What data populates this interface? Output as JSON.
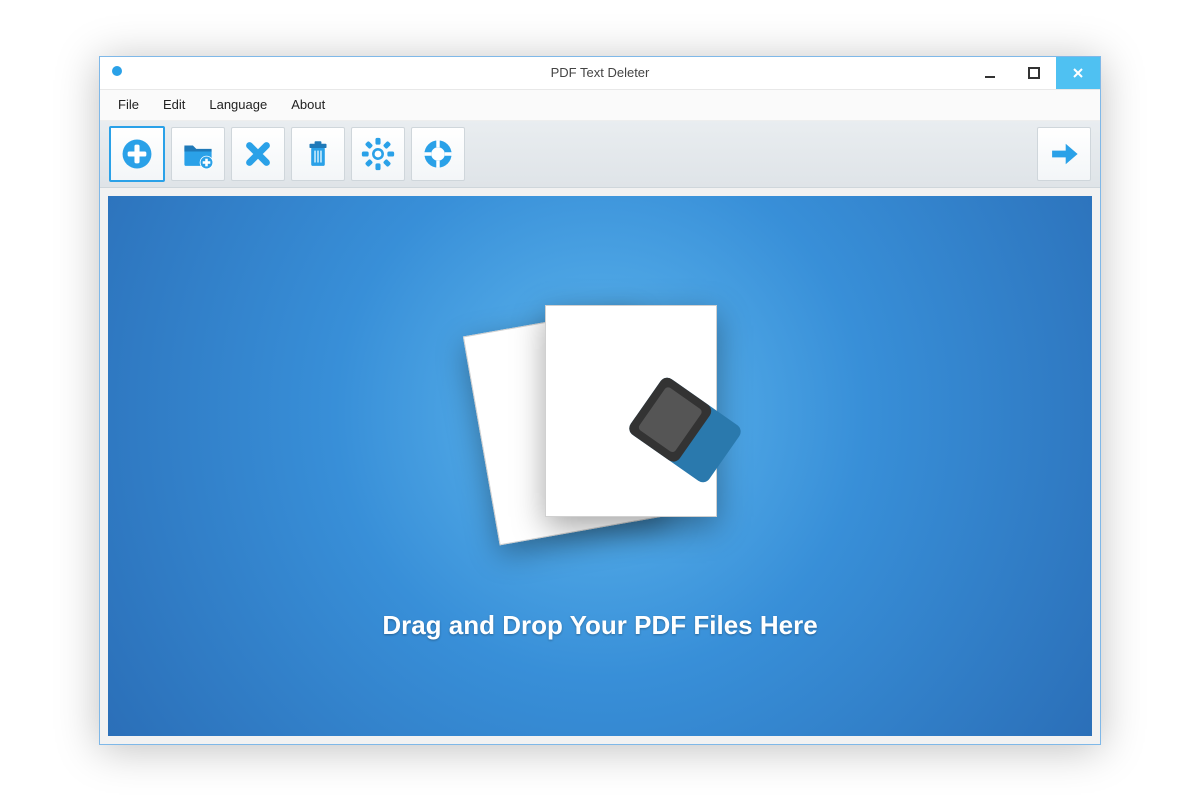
{
  "window": {
    "title": "PDF Text Deleter"
  },
  "menu": {
    "items": [
      "File",
      "Edit",
      "Language",
      "About"
    ]
  },
  "toolbar": {
    "add": {
      "name": "add-file",
      "icon": "plus-icon"
    },
    "add_folder": {
      "name": "add-folder",
      "icon": "folder-plus-icon"
    },
    "remove": {
      "name": "remove",
      "icon": "x-icon"
    },
    "clear": {
      "name": "clear-all",
      "icon": "trash-icon"
    },
    "settings": {
      "name": "settings",
      "icon": "gear-icon"
    },
    "help": {
      "name": "help",
      "icon": "lifering-icon"
    },
    "run": {
      "name": "run",
      "icon": "arrow-right-icon"
    }
  },
  "droparea": {
    "message": "Drag and Drop Your PDF Files Here"
  },
  "colors": {
    "accent": "#2aa1e8",
    "accent_dark": "#1f79b8"
  }
}
